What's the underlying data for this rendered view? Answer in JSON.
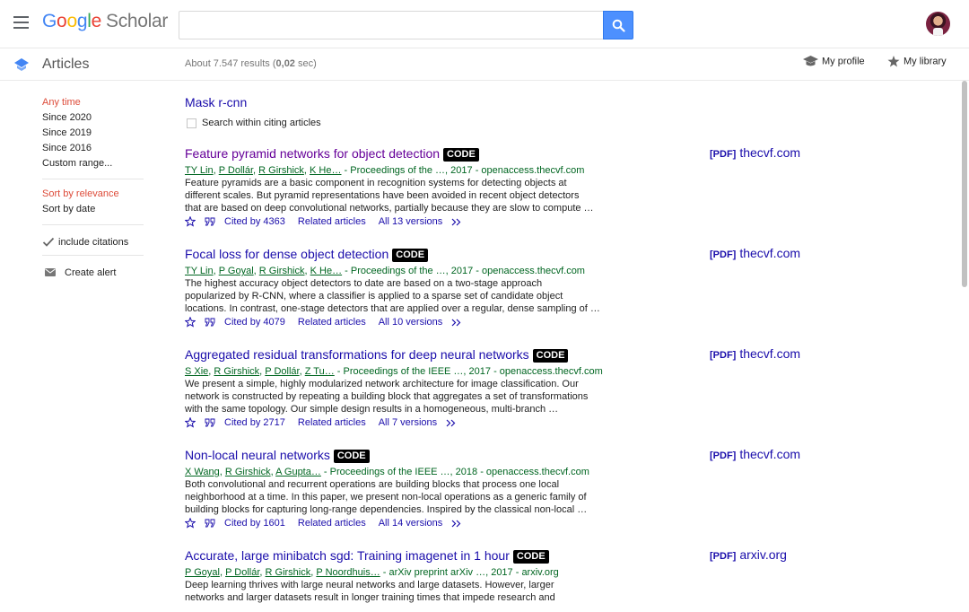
{
  "header": {
    "logo_letters": [
      "G",
      "o",
      "o",
      "g",
      "l",
      "e"
    ],
    "logo_suffix": "Scholar",
    "search_placeholder": ""
  },
  "subheader": {
    "section": "Articles",
    "results_prefix": "About 7.547 results (",
    "results_time": "0,02",
    "results_suffix": " sec)",
    "my_profile": "My profile",
    "my_library": "My library"
  },
  "sidebar": {
    "time_filters": [
      "Any time",
      "Since 2020",
      "Since 2019",
      "Since 2016",
      "Custom range..."
    ],
    "sort_options": [
      "Sort by relevance",
      "Sort by date"
    ],
    "include_citations": "include citations",
    "create_alert": "Create alert"
  },
  "main": {
    "query_title": "Mask r-cnn",
    "search_within": "Search within citing articles",
    "code_label": "CODE",
    "pdf_tag": "[PDF]",
    "related_label": "Related articles",
    "results": [
      {
        "title": "Feature pyramid networks for object detection",
        "authors": [
          "TY Lin",
          "P Dollár",
          "R Girshick",
          "K He…"
        ],
        "source": " - Proceedings of the …, 2017 - openaccess.thecvf.com",
        "snippet": [
          "Feature pyramids are a basic component in recognition systems for detecting objects at",
          "different scales. But pyramid representations have been avoided in recent object detectors",
          "that are based on deep convolutional networks, partially because they are slow to compute …"
        ],
        "cited_by": "Cited by 4363",
        "versions": "All 13 versions",
        "pdf_site": "thecvf.com"
      },
      {
        "title": "Focal loss for dense object detection",
        "authors": [
          "TY Lin",
          "P Goyal",
          "R Girshick",
          "K He…"
        ],
        "source": " - Proceedings of the …, 2017 - openaccess.thecvf.com",
        "snippet": [
          "The highest accuracy object detectors to date are based on a two-stage approach",
          "popularized by R-CNN, where a classifier is applied to a sparse set of candidate object",
          "locations. In contrast, one-stage detectors that are applied over a regular, dense sampling of …"
        ],
        "cited_by": "Cited by 4079",
        "versions": "All 10 versions",
        "pdf_site": "thecvf.com"
      },
      {
        "title": "Aggregated residual transformations for deep neural networks",
        "authors": [
          "S Xie",
          "R Girshick",
          "P Dollár",
          "Z Tu…"
        ],
        "source": " - Proceedings of the IEEE …, 2017 - openaccess.thecvf.com",
        "snippet": [
          "We present a simple, highly modularized network architecture for image classification. Our",
          "network is constructed by repeating a building block that aggregates a set of transformations",
          "with the same topology. Our simple design results in a homogeneous, multi-branch …"
        ],
        "cited_by": "Cited by 2717",
        "versions": "All 7 versions",
        "pdf_site": "thecvf.com"
      },
      {
        "title": "Non-local neural networks",
        "authors": [
          "X Wang",
          "R Girshick",
          "A Gupta…"
        ],
        "source": " - Proceedings of the IEEE …, 2018 - openaccess.thecvf.com",
        "snippet": [
          "Both convolutional and recurrent operations are building blocks that process one local",
          "neighborhood at a time. In this paper, we present non-local operations as a generic family of",
          "building blocks for capturing long-range dependencies. Inspired by the classical non-local …"
        ],
        "cited_by": "Cited by 1601",
        "versions": "All 14 versions",
        "pdf_site": "thecvf.com"
      },
      {
        "title": "Accurate, large minibatch sgd: Training imagenet in 1 hour",
        "authors": [
          "P Goyal",
          "P Dollár",
          "R Girshick",
          "P Noordhuis…"
        ],
        "source": " - arXiv preprint arXiv …, 2017 - arxiv.org",
        "snippet": [
          "Deep learning thrives with large neural networks and large datasets. However, larger",
          "networks and larger datasets result in longer training times that impede research and"
        ],
        "cited_by": "",
        "versions": "",
        "pdf_site": "arxiv.org"
      }
    ]
  },
  "colors": {
    "link": "#1a0dab",
    "visited": "#660099",
    "source_green": "#006621",
    "active_filter": "#dd4b39",
    "search_button": "#4d90fe"
  }
}
